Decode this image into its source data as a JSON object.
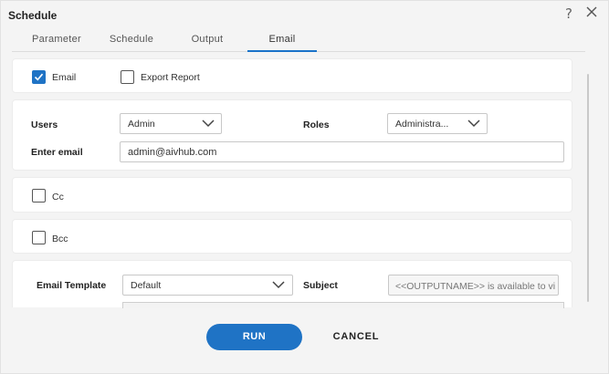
{
  "dialog": {
    "title": "Schedule",
    "help_icon": "question-mark-icon",
    "help_glyph": "?",
    "close_icon": "close-icon"
  },
  "tabs": [
    {
      "label": "Parameter",
      "active": false
    },
    {
      "label": "Schedule",
      "active": false
    },
    {
      "label": "Output",
      "active": false
    },
    {
      "label": "Email",
      "active": true
    }
  ],
  "options": {
    "email": {
      "label": "Email",
      "checked": true
    },
    "export_report": {
      "label": "Export Report",
      "checked": false
    }
  },
  "recipients": {
    "users_label": "Users",
    "users_value": "Admin",
    "roles_label": "Roles",
    "roles_value": "Administra...",
    "enter_email_label": "Enter email",
    "enter_email_value": "admin@aivhub.com"
  },
  "cc": {
    "label": "Cc",
    "checked": false
  },
  "bcc": {
    "label": "Bcc",
    "checked": false
  },
  "template": {
    "email_template_label": "Email Template",
    "email_template_value": "Default",
    "subject_label": "Subject",
    "subject_value": "<<OUTPUTNAME>> is available to vi"
  },
  "footer": {
    "run_label": "RUN",
    "cancel_label": "CANCEL"
  },
  "colors": {
    "accent": "#1f73c5",
    "background": "#f4f4f4",
    "panel": "#ffffff"
  }
}
